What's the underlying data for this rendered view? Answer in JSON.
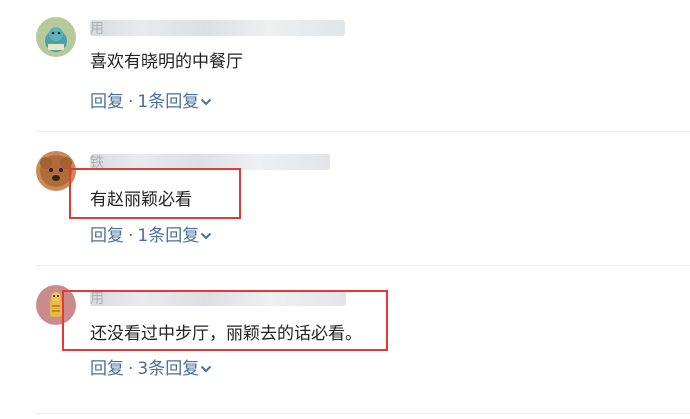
{
  "comments": [
    {
      "username": "用",
      "text": "喜欢有晓明的中餐厅",
      "reply_label": "回复",
      "separator": "·",
      "replies_label": "1条回复"
    },
    {
      "username": "铁",
      "text": "有赵丽颖必看",
      "reply_label": "回复",
      "separator": "·",
      "replies_label": "1条回复"
    },
    {
      "username": "用",
      "text": "还没看过中步厅，丽颖去的话必看。",
      "reply_label": "回复",
      "separator": "·",
      "replies_label": "3条回复"
    }
  ],
  "colors": {
    "link": "#4a6f9c",
    "highlight_border": "#e53935",
    "divider": "#eeeeee"
  }
}
